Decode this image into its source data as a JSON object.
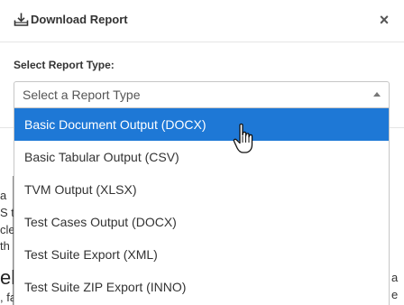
{
  "modal": {
    "title": "Download Report",
    "close_label": "×",
    "field_label": "Select Report Type:",
    "select_placeholder": "Select a Report Type"
  },
  "dropdown": {
    "options": [
      "Basic Document Output (DOCX)",
      "Basic Tabular Output (CSV)",
      "TVM Output (XLSX)",
      "Test Cases Output (DOCX)",
      "Test Suite Export (XML)",
      "Test Suite ZIP Export (INNO)"
    ],
    "highlighted_index": 0
  },
  "background": {
    "frag_1": "a",
    "frag_2": "S t",
    "frag_3": "cle",
    "frag_4": "th",
    "frag_5": "ele",
    "frag_6": ", fa",
    "frag_7": "a",
    "frag_8": "e"
  },
  "colors": {
    "highlight": "#1e78d6",
    "backdrop": "#8a8a8a"
  },
  "icons": {
    "download": "download-icon",
    "caret": "caret-up-icon",
    "cursor": "hand-pointer-icon"
  }
}
